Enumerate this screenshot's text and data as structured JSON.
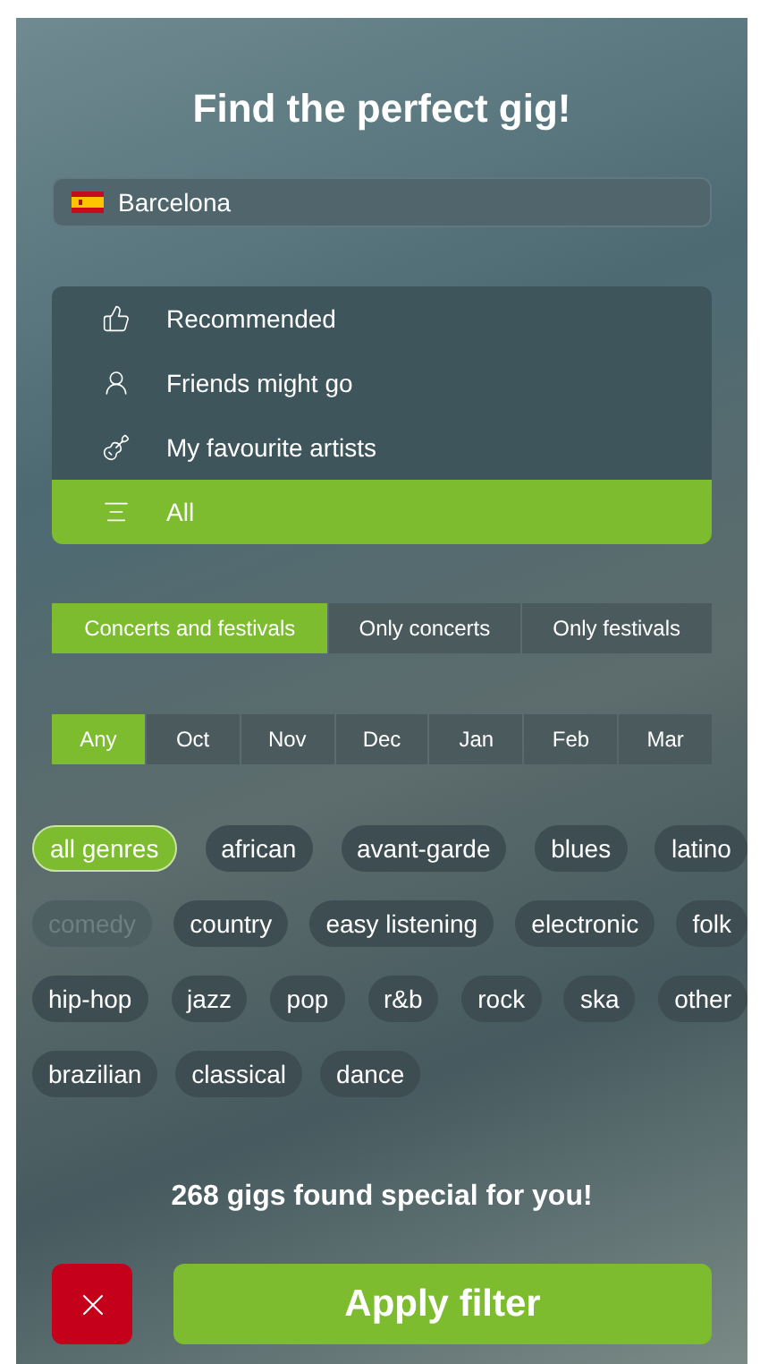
{
  "title": "Find the perfect gig!",
  "city": {
    "value": "Barcelona"
  },
  "sources": [
    {
      "label": "Recommended",
      "kind": "thumb",
      "selected": false
    },
    {
      "label": "Friends might go",
      "kind": "friends",
      "selected": false
    },
    {
      "label": "My favourite artists",
      "kind": "guitar",
      "selected": false
    },
    {
      "label": "All",
      "kind": "list",
      "selected": true
    }
  ],
  "event_types": [
    {
      "label": "Concerts and festivals",
      "selected": true
    },
    {
      "label": "Only concerts",
      "selected": false
    },
    {
      "label": "Only festivals",
      "selected": false
    }
  ],
  "months": [
    {
      "label": "Any",
      "selected": true
    },
    {
      "label": "Oct",
      "selected": false
    },
    {
      "label": "Nov",
      "selected": false
    },
    {
      "label": "Dec",
      "selected": false
    },
    {
      "label": "Jan",
      "selected": false
    },
    {
      "label": "Feb",
      "selected": false
    },
    {
      "label": "Mar",
      "selected": false
    }
  ],
  "genre_rows": [
    [
      {
        "label": "all genres",
        "selected": true,
        "disabled": false
      },
      {
        "label": "african",
        "selected": false,
        "disabled": false
      },
      {
        "label": "avant-garde",
        "selected": false,
        "disabled": false
      },
      {
        "label": "blues",
        "selected": false,
        "disabled": false
      },
      {
        "label": "latino",
        "selected": false,
        "disabled": false
      }
    ],
    [
      {
        "label": "comedy",
        "selected": false,
        "disabled": true
      },
      {
        "label": "country",
        "selected": false,
        "disabled": false
      },
      {
        "label": "easy listening",
        "selected": false,
        "disabled": false
      },
      {
        "label": "electronic",
        "selected": false,
        "disabled": false
      },
      {
        "label": "folk",
        "selected": false,
        "disabled": false
      }
    ],
    [
      {
        "label": "hip-hop",
        "selected": false,
        "disabled": false
      },
      {
        "label": "jazz",
        "selected": false,
        "disabled": false
      },
      {
        "label": "pop",
        "selected": false,
        "disabled": false
      },
      {
        "label": "r&b",
        "selected": false,
        "disabled": false
      },
      {
        "label": "rock",
        "selected": false,
        "disabled": false
      },
      {
        "label": "ska",
        "selected": false,
        "disabled": false
      },
      {
        "label": "other",
        "selected": false,
        "disabled": false
      }
    ],
    [
      {
        "label": "brazilian",
        "selected": false,
        "disabled": false
      },
      {
        "label": "classical",
        "selected": false,
        "disabled": false
      },
      {
        "label": "dance",
        "selected": false,
        "disabled": false
      }
    ]
  ],
  "result": "268 gigs found special for you!",
  "apply_button": "Apply filter"
}
